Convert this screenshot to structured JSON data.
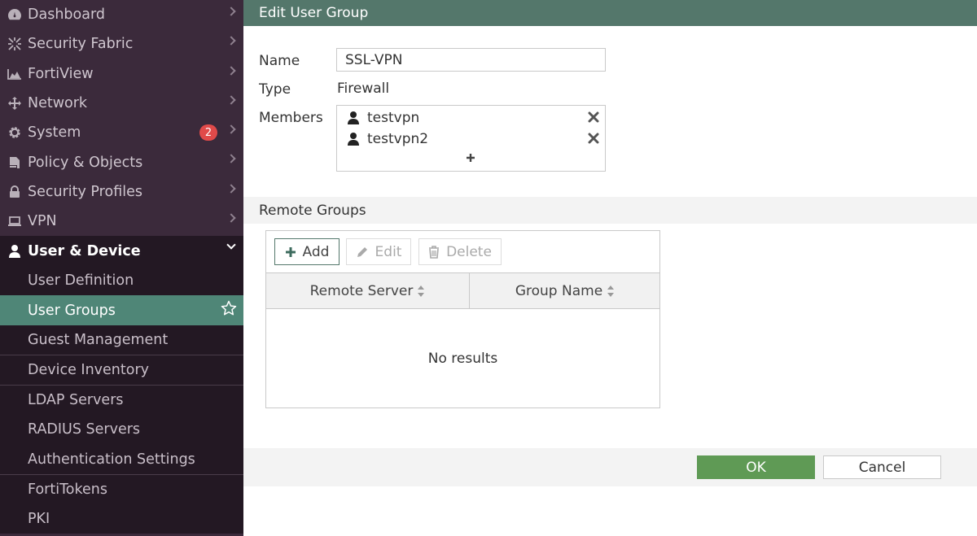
{
  "sidebar": {
    "items": [
      {
        "label": "Dashboard",
        "icon": "dashboard-icon"
      },
      {
        "label": "Security Fabric",
        "icon": "security-fabric-icon"
      },
      {
        "label": "FortiView",
        "icon": "fortiview-icon"
      },
      {
        "label": "Network",
        "icon": "network-icon"
      },
      {
        "label": "System",
        "icon": "gear-icon",
        "badge": "2"
      },
      {
        "label": "Policy & Objects",
        "icon": "policy-icon"
      },
      {
        "label": "Security Profiles",
        "icon": "lock-icon"
      },
      {
        "label": "VPN",
        "icon": "laptop-icon"
      },
      {
        "label": "User & Device",
        "icon": "user-icon"
      }
    ],
    "sub_items": [
      {
        "label": "User Definition"
      },
      {
        "label": "User Groups"
      },
      {
        "label": "Guest Management"
      },
      {
        "label": "Device Inventory"
      },
      {
        "label": "LDAP Servers"
      },
      {
        "label": "RADIUS Servers"
      },
      {
        "label": "Authentication Settings"
      },
      {
        "label": "FortiTokens"
      },
      {
        "label": "PKI"
      }
    ],
    "active_sub_item": "User Groups"
  },
  "header": {
    "title": "Edit User Group"
  },
  "form": {
    "name_label": "Name",
    "name_value": "SSL-VPN",
    "type_label": "Type",
    "type_value": "Firewall",
    "members_label": "Members",
    "members": [
      {
        "name": "testvpn"
      },
      {
        "name": "testvpn2"
      }
    ]
  },
  "remote_groups": {
    "title": "Remote Groups",
    "toolbar": {
      "add_label": "Add",
      "edit_label": "Edit",
      "delete_label": "Delete"
    },
    "columns": [
      "Remote Server",
      "Group Name"
    ],
    "empty_text": "No results"
  },
  "footer": {
    "ok_label": "OK",
    "cancel_label": "Cancel"
  },
  "colors": {
    "header_bg": "#54776b",
    "sidebar_bg": "#3b2a3b",
    "active_item": "#4f8677",
    "ok_button": "#5f9a55",
    "badge": "#e04a4a"
  }
}
